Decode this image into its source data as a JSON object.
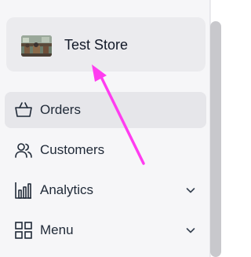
{
  "store": {
    "name": "Test Store",
    "thumbnail_icon": "store-photo"
  },
  "nav": {
    "items": [
      {
        "label": "Orders",
        "icon": "shopping-basket-icon",
        "active": true,
        "has_chevron": false
      },
      {
        "label": "Customers",
        "icon": "users-icon",
        "active": false,
        "has_chevron": false
      },
      {
        "label": "Analytics",
        "icon": "bar-chart-icon",
        "active": false,
        "has_chevron": true
      },
      {
        "label": "Menu",
        "icon": "grid-icon",
        "active": false,
        "has_chevron": true
      }
    ]
  },
  "colors": {
    "annotation_arrow": "#ff3df0",
    "active_bg": "#e6e6ea",
    "card_bg": "#ebebee"
  }
}
